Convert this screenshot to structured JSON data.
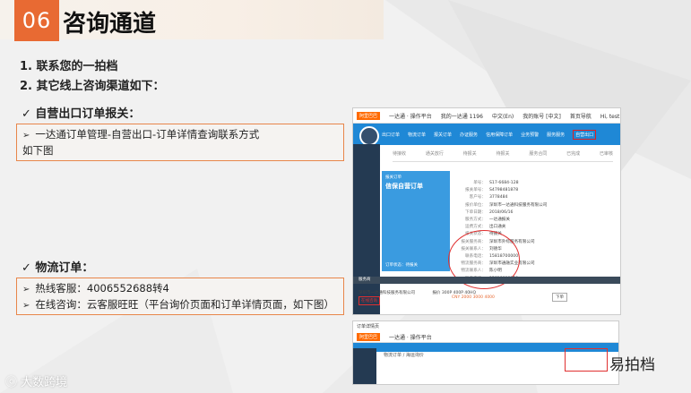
{
  "header": {
    "number": "06",
    "title": "咨询通道"
  },
  "list": [
    "1.  联系您的一拍档",
    "2.  其它线上咨询渠道如下："
  ],
  "section_self": {
    "heading": "✓  自营出口订单报关：",
    "lines": [
      "一达通订单管理-自营出口-订单详情查询联系方式",
      "如下图"
    ]
  },
  "section_logistics": {
    "heading": "✓  物流订单：",
    "lines": [
      "热线客服：4006552688转4",
      "在线咨询：云客服旺旺（平台询价页面和订单详情页面，如下图）"
    ]
  },
  "screenshot1": {
    "logo": "阿里巴巴",
    "platform": "一达通 · 操作平台",
    "topbar_items": [
      "我的一达通 1196",
      "中文(En)",
      "我的账号 [中文]",
      "首页导航",
      "Hi, test 我的",
      "我"
    ],
    "nav": [
      "出口订单",
      "物流订单",
      "报关订单",
      "办证服务",
      "信用保障订单",
      "业务预警",
      "服务服务",
      "自营出口"
    ],
    "steps": [
      "待接收",
      "通关放行",
      "待报关",
      "待报关",
      "服务合同",
      "已完成",
      "已审核"
    ],
    "panel_title": "信保自营订单",
    "panel_sub": "报关订单",
    "panel_status": "订单状态：待报关",
    "info": [
      {
        "k": "单号",
        "v": "S17-6684-128"
      },
      {
        "k": "报关单号",
        "v": "S4798481878"
      },
      {
        "k": "客户号",
        "v": "3778484"
      },
      {
        "k": "报价单位",
        "v": "深圳市一达通科技服务有限公司"
      },
      {
        "k": "下单日期",
        "v": "2018/06/16"
      },
      {
        "k": "服务方式",
        "v": "一达通报关"
      },
      {
        "k": "运费方式",
        "v": "出口通关"
      },
      {
        "k": "报关状态",
        "v": "待报关"
      },
      {
        "k": "报关服务商",
        "v": "深圳市外综服务有限公司"
      },
      {
        "k": "报关联系人",
        "v": "刘德华"
      },
      {
        "k": "联系电话",
        "v": "15818700000"
      },
      {
        "k": "物流服务商",
        "v": "深圳市通融实业有限公司"
      },
      {
        "k": "物流联系人",
        "v": "陈小明"
      },
      {
        "k": "联系电话",
        "v": "15818000000"
      }
    ],
    "table_head": "服务商",
    "table_row": "深圳市一达通科技服务有限公司",
    "table_values": "报价  300P  400P  40HQ",
    "table_values2": "CNY  2000  3000  4000",
    "ww_label": "在线咨询",
    "order_btn": "下单"
  },
  "screenshot2": {
    "logo": "阿里巴巴",
    "platform": "一达通 · 操作平台",
    "crumb": "物流订单 / 海运询价",
    "header_label": "订单详情页"
  },
  "brand": {
    "name": "易拍档",
    "watermark": "大数跨境"
  },
  "colors": {
    "accent": "#e86a33",
    "nav_blue": "#1f88d6",
    "alert_red": "#e02020"
  }
}
